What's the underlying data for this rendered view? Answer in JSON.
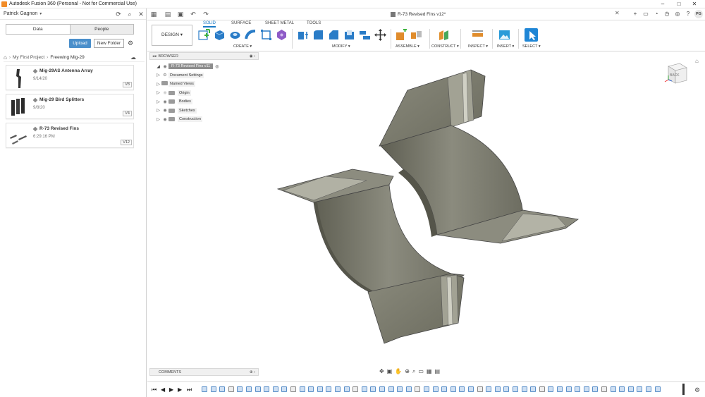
{
  "window": {
    "title": "Autodesk Fusion 360 (Personal - Not for Commercial Use)",
    "controls": [
      "–",
      "□",
      "✕"
    ]
  },
  "datapanel": {
    "user": "Patrick Gagnon",
    "tabs": [
      "Data",
      "People"
    ],
    "upload_label": "Upload",
    "new_folder_label": "New Folder",
    "breadcrumb": [
      "My First Project",
      "Freewing Mig-29"
    ],
    "items": [
      {
        "name": "Mig-29AS Antenna Array",
        "date": "9/14/20",
        "version": "V8"
      },
      {
        "name": "Mig-29 Bird Splitters",
        "date": "9/8/20",
        "version": "V4"
      },
      {
        "name": "R-73 Revised Fins",
        "date": "6:29:16 PM",
        "version": "V12"
      }
    ]
  },
  "document": {
    "tab_title": "R-73 Revised Fins v12*"
  },
  "ribbon": {
    "workspace": "DESIGN",
    "tabs": [
      "SOLID",
      "SURFACE",
      "SHEET METAL",
      "TOOLS"
    ],
    "active_tab": "SOLID",
    "groups": [
      "CREATE",
      "MODIFY",
      "ASSEMBLE",
      "CONSTRUCT",
      "INSPECT",
      "INSERT",
      "SELECT"
    ]
  },
  "browser": {
    "header": "BROWSER",
    "root": "R-73 Revised Fins v11",
    "nodes": [
      "Document Settings",
      "Named Views",
      "Origin",
      "Bodies",
      "Sketches",
      "Construction"
    ]
  },
  "viewcube": {
    "face_label": "BACK"
  },
  "comments": {
    "label": "COMMENTS"
  },
  "profile": {
    "initials": "PG"
  },
  "colors": {
    "accent": "#1a7ac6",
    "upload": "#4a8fcb",
    "model": "#7a7a6e"
  }
}
